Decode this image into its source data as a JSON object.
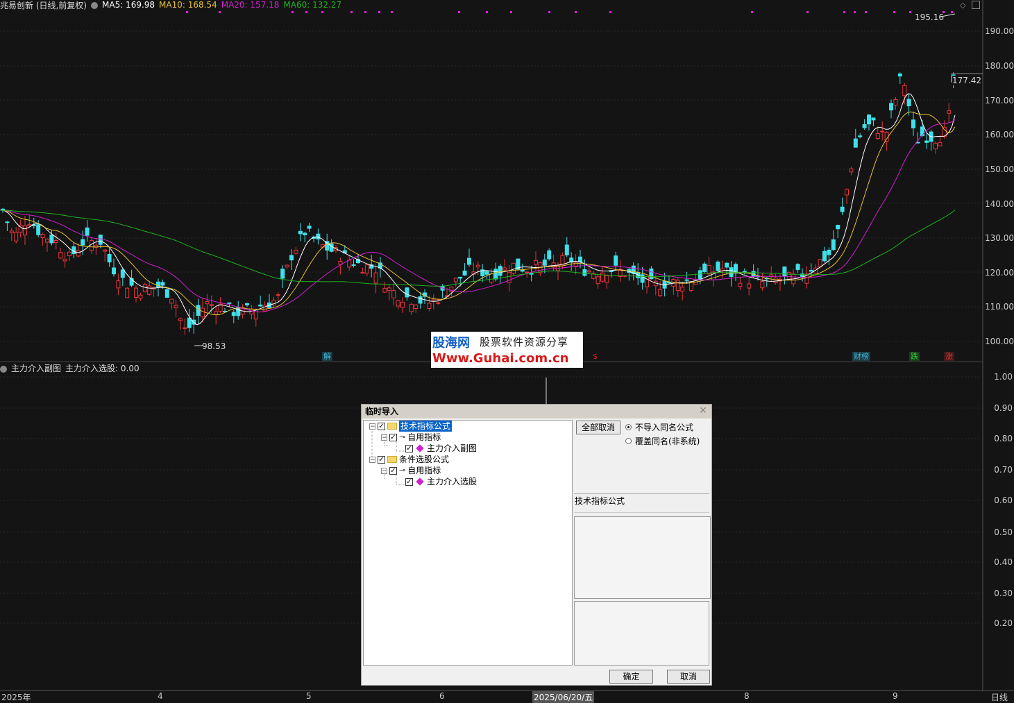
{
  "header": {
    "stock_title": "兆易创新 (日线,前复权)",
    "ma5": "MA5: 169.98",
    "ma10": "MA10: 168.54",
    "ma20": "MA20: 157.18",
    "ma60": "MA60: 132.27",
    "colors": {
      "ma5": "#ffffff",
      "ma10": "#e8c232",
      "ma20": "#d020d0",
      "ma60": "#1fb31f"
    }
  },
  "price_axis": [
    "190.00",
    "180.00",
    "170.00",
    "160.00",
    "150.00",
    "140.00",
    "130.00",
    "120.00",
    "110.00",
    "100.00"
  ],
  "price_annotations": {
    "high": "195.16",
    "low": "98.53",
    "last": "177.42"
  },
  "sub_chart": {
    "legend_name": "主力介入副图",
    "legend_value": "主力介入选股: 0.00",
    "axis": [
      "1.00",
      "0.90",
      "0.80",
      "0.70",
      "0.60",
      "0.50",
      "0.40",
      "0.30",
      "0.20"
    ]
  },
  "markers": [
    {
      "text": "解",
      "color": "#3fb7d6"
    },
    {
      "text": "$",
      "color": "#d92020"
    },
    {
      "text": "财榜",
      "color": "#3fb7d6"
    },
    {
      "text": "跌",
      "color": "#2fd02f"
    },
    {
      "text": "涨",
      "color": "#e03030"
    }
  ],
  "xaxis": {
    "labels": [
      "2025年",
      "4",
      "5",
      "6",
      "2025/06/20/五",
      "8",
      "9"
    ],
    "period": "日线"
  },
  "watermark": {
    "line1": "股海网",
    "line2": "股票软件资源分享",
    "line3": "Www.Guhai.com.cn"
  },
  "dialog": {
    "title": "临时导入",
    "tree": [
      {
        "label": "技术指标公式",
        "level": 0,
        "type": "folder",
        "selected": true
      },
      {
        "label": "自用指标",
        "level": 1,
        "type": "group"
      },
      {
        "label": "主力介入副图",
        "level": 2,
        "type": "item"
      },
      {
        "label": "条件选股公式",
        "level": 0,
        "type": "folder"
      },
      {
        "label": "自用指标",
        "level": 1,
        "type": "group"
      },
      {
        "label": "主力介入选股",
        "level": 2,
        "type": "item"
      }
    ],
    "clear_all": "全部取消",
    "option_skip": "不导入同名公式",
    "option_overwrite": "覆盖同名(非系统)",
    "description": "技术指标公式",
    "ok": "确定",
    "cancel": "取消"
  }
}
